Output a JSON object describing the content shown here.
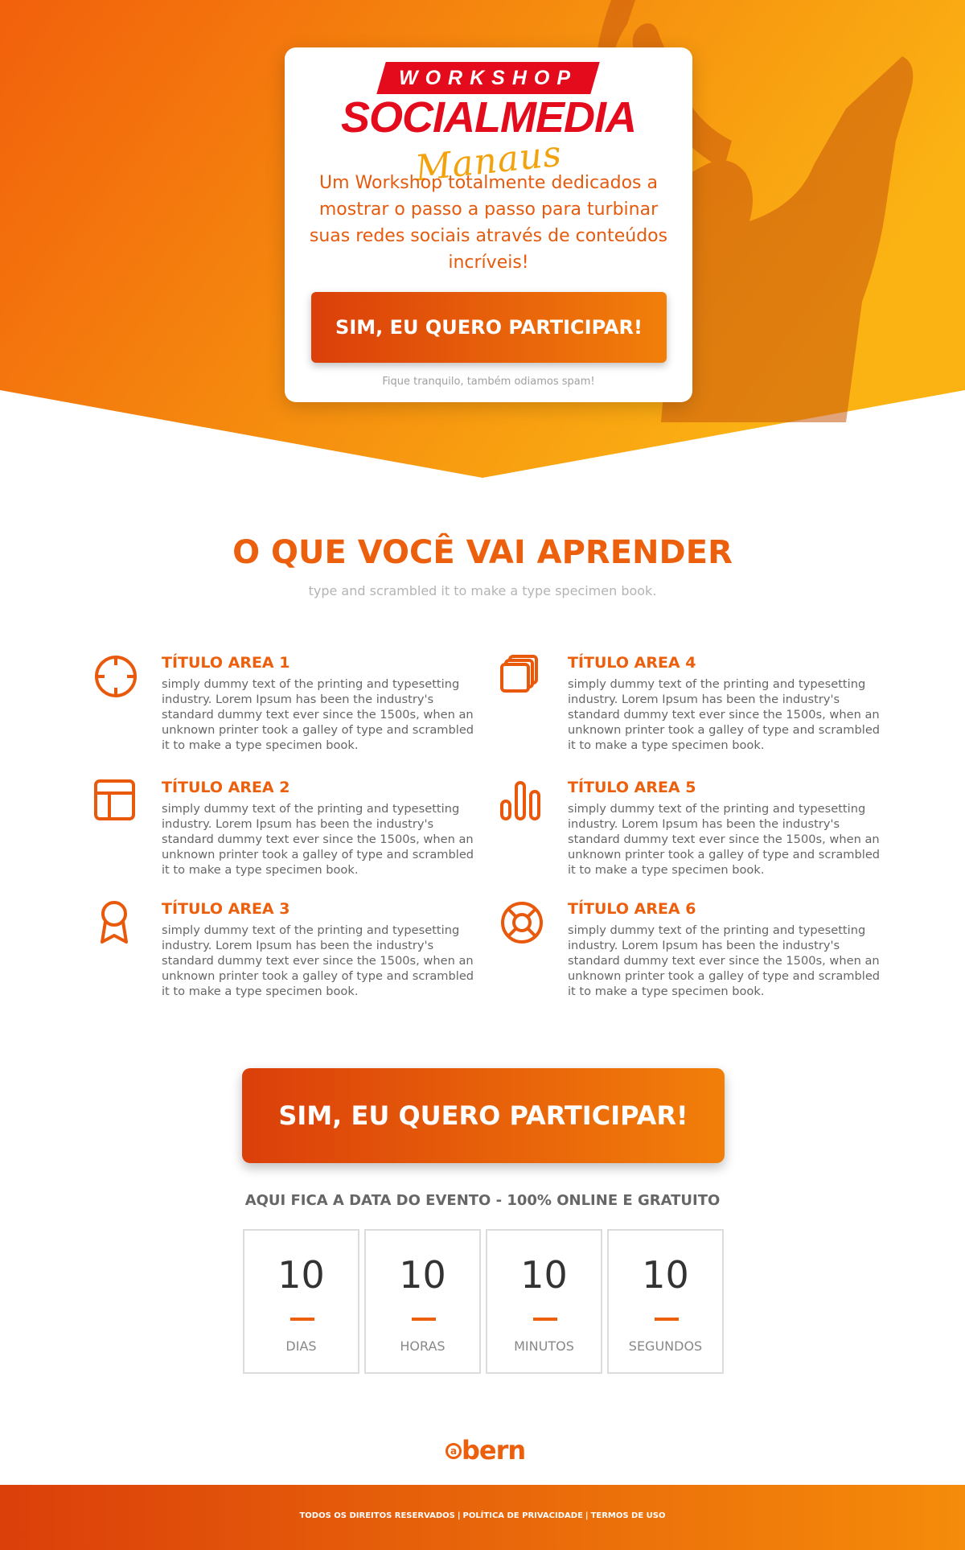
{
  "hero": {
    "logo_banner": "WORKSHOP",
    "logo_main": "SOCIALMEDIA",
    "logo_city": "Manaus",
    "description": "Um Workshop totalmente dedicados a mostrar o passo a passo para turbinar suas redes sociais através de conteúdos incríveis!",
    "cta_label": "SIM, EU QUERO PARTICIPAR!",
    "spam_note": "Fique tranquilo, também odiamos spam!"
  },
  "learn": {
    "title": "O QUE VOCÊ VAI APRENDER",
    "subtitle": "type and scrambled it to make a type specimen book.",
    "features": [
      {
        "title": "TÍTULO AREA 1",
        "icon": "crosshair-icon",
        "text": "simply dummy text of the printing and typesetting industry. Lorem Ipsum has been the industry's standard dummy text ever since the 1500s, when an unknown printer took a galley of type and scrambled it to make a type specimen book."
      },
      {
        "title": "TÍTULO AREA 2",
        "icon": "layout-icon",
        "text": "simply dummy text of the printing and typesetting industry. Lorem Ipsum has been the industry's standard dummy text ever since the 1500s, when an unknown printer took a galley of type and scrambled it to make a type specimen book."
      },
      {
        "title": "TÍTULO AREA 3",
        "icon": "award-icon",
        "text": "simply dummy text of the printing and typesetting industry. Lorem Ipsum has been the industry's standard dummy text ever since the 1500s, when an unknown printer took a galley of type and scrambled it to make a type specimen book."
      },
      {
        "title": "TÍTULO AREA 4",
        "icon": "layers-icon",
        "text": "simply dummy text of the printing and typesetting industry. Lorem Ipsum has been the industry's standard dummy text ever since the 1500s, when an unknown printer took a galley of type and scrambled it to make a type specimen book."
      },
      {
        "title": "TÍTULO AREA 5",
        "icon": "bar-chart-icon",
        "text": "simply dummy text of the printing and typesetting industry. Lorem Ipsum has been the industry's standard dummy text ever since the 1500s, when an unknown printer took a galley of type and scrambled it to make a type specimen book."
      },
      {
        "title": "TÍTULO AREA 6",
        "icon": "life-buoy-icon",
        "text": "simply dummy text of the printing and typesetting industry. Lorem Ipsum has been the industry's standard dummy text ever since the 1500s, when an unknown printer took a galley of type and scrambled it to make a type specimen book."
      }
    ]
  },
  "cta_big": {
    "label": "SIM, EU QUERO PARTICIPAR!"
  },
  "event": {
    "info": "AQUI FICA A DATA DO EVENTO - 100% ONLINE E GRATUITO"
  },
  "countdown": [
    {
      "value": "10",
      "label": "DIAS"
    },
    {
      "value": "10",
      "label": "HORAS"
    },
    {
      "value": "10",
      "label": "MINUTOS"
    },
    {
      "value": "10",
      "label": "SEGUNDOS"
    }
  ],
  "brand": {
    "at": "a",
    "name": "bern"
  },
  "footer": {
    "links": [
      "TODOS OS DIREITOS RESERVADOS",
      "POLÍTICA DE PRIVACIDADE",
      "TERMOS DE USO"
    ],
    "separator": "|"
  },
  "colors": {
    "accent": "#ec5f0c",
    "gradient_start": "#db3f0a",
    "gradient_end": "#f27f0a",
    "logo_red": "#e30b1c",
    "logo_gold": "#f2a20c"
  }
}
